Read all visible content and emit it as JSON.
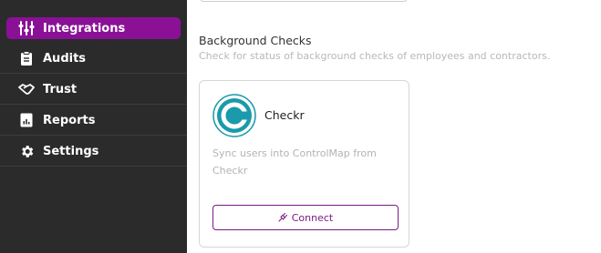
{
  "sidebar": {
    "items": [
      {
        "label": "Integrations",
        "icon": "integrations-icon",
        "active": true
      },
      {
        "label": "Audits",
        "icon": "clipboard-icon"
      },
      {
        "label": "Trust",
        "icon": "handshake-icon"
      },
      {
        "label": "Reports",
        "icon": "report-icon"
      },
      {
        "label": "Settings",
        "icon": "gear-icon"
      }
    ],
    "active_color": "#8a1196",
    "background": "#2b2b2b"
  },
  "main": {
    "section": {
      "title": "Background Checks",
      "subtitle": "Check for status of background checks of employees and contractors."
    },
    "card": {
      "name": "Checkr",
      "logo_icon": "checkr-logo",
      "description": "Sync users into ControlMap from Checkr",
      "button_label": "Connect",
      "button_icon": "plug-icon",
      "accent": "#7b1a86",
      "logo_color": "#1a9aaa"
    }
  }
}
